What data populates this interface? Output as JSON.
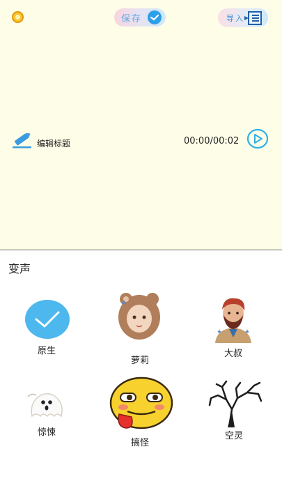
{
  "toolbar": {
    "save_label": "保存",
    "import_label": "导入"
  },
  "editor": {
    "edit_title_label": "编辑标题",
    "time": "00:00/00:02"
  },
  "voice_panel": {
    "title": "变声",
    "effects": [
      {
        "label": "原生",
        "selected": true
      },
      {
        "label": "萝莉",
        "selected": false
      },
      {
        "label": "大叔",
        "selected": false
      },
      {
        "label": "惊悚",
        "selected": false
      },
      {
        "label": "搞怪",
        "selected": false
      },
      {
        "label": "空灵",
        "selected": false
      }
    ]
  },
  "colors": {
    "accent_blue": "#2d9fe9",
    "selected_circle": "#4db8ee",
    "top_background": "#fefee8"
  }
}
